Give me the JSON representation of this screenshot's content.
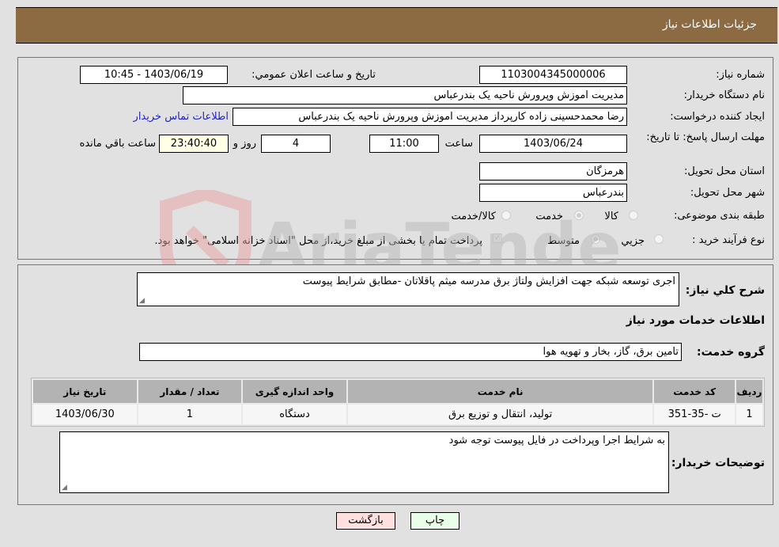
{
  "header": {
    "title": "جزئیات اطلاعات نیاز"
  },
  "form": {
    "need_number": {
      "label": "شماره نیاز:",
      "value": "1103004345000006"
    },
    "announce": {
      "label": "تاریخ و ساعت اعلان عمومي:",
      "value": "1403/06/19 - 10:45"
    },
    "buyer_org": {
      "label": "نام دستگاه خریدار:",
      "value": "مدیریت اموزش وپرورش ناحیه یک بندرعباس"
    },
    "requester": {
      "label": "ایجاد کننده درخواست:",
      "value": "رضا محمدحسینی زاده کارپرداز مدیریت اموزش وپرورش ناحیه یک بندرعباس"
    },
    "buyer_contact_link": "اطلاعات تماس خریدار",
    "deadline": {
      "label": "مهلت ارسال پاسخ: تا تاریخ:",
      "date": "1403/06/24",
      "time_label": "ساعت",
      "time": "11:00",
      "days": "4",
      "days_label": "روز و",
      "remaining": "23:40:40",
      "remaining_label": "ساعت باقي مانده"
    },
    "province": {
      "label": "استان محل تحویل:",
      "value": "هرمزگان"
    },
    "city": {
      "label": "شهر محل تحویل:",
      "value": "بندرعباس"
    },
    "category": {
      "label": "طبقه بندی موضوعی:",
      "options": [
        "کالا",
        "خدمت",
        "کالا/خدمت"
      ],
      "selected": "خدمت"
    },
    "purchase_type": {
      "label": "نوع فرآیند خرید :",
      "options": [
        "جزيي",
        "متوسط"
      ],
      "selected": "متوسط",
      "treasury_note": "پرداخت تمام یا بخشی از مبلغ خرید،از محل \"اسناد خزانه اسلامی\" خواهد بود."
    }
  },
  "details": {
    "summary_label": "شرح کلي نیاز:",
    "summary_value": "اجری توسعه شبکه جهت افزایش ولتاژ برق مدرسه میثم پاقلاتان -مطابق شرایط پیوست",
    "services_heading": "اطلاعات خدمات مورد نیاز",
    "service_group_label": "گروه خدمت:",
    "service_group_value": "تامین برق، گاز، بخار و تهویه هوا",
    "table": {
      "headers": [
        "ردیف",
        "کد خدمت",
        "نام خدمت",
        "واحد اندازه گیری",
        "تعداد / مقدار",
        "تاریخ نیاز"
      ],
      "rows": [
        [
          "1",
          "ت -35-351",
          "تولید، انتقال و توزیع برق",
          "دستگاه",
          "1",
          "1403/06/30"
        ]
      ]
    },
    "buyer_notes_label": "توضیحات خریدار:",
    "buyer_notes_value": "به شرایط اجرا وپرداخت در فایل پیوست توجه شود"
  },
  "buttons": {
    "print": "چاپ",
    "back": "بازگشت"
  },
  "watermark": "AriaTender.neT",
  "colors": {
    "header_bg": "#8d6b42",
    "print_bg": "#eaffea",
    "back_bg": "#ffe0e0",
    "remaining_bg": "#ffffe5",
    "link": "#2222cc"
  }
}
